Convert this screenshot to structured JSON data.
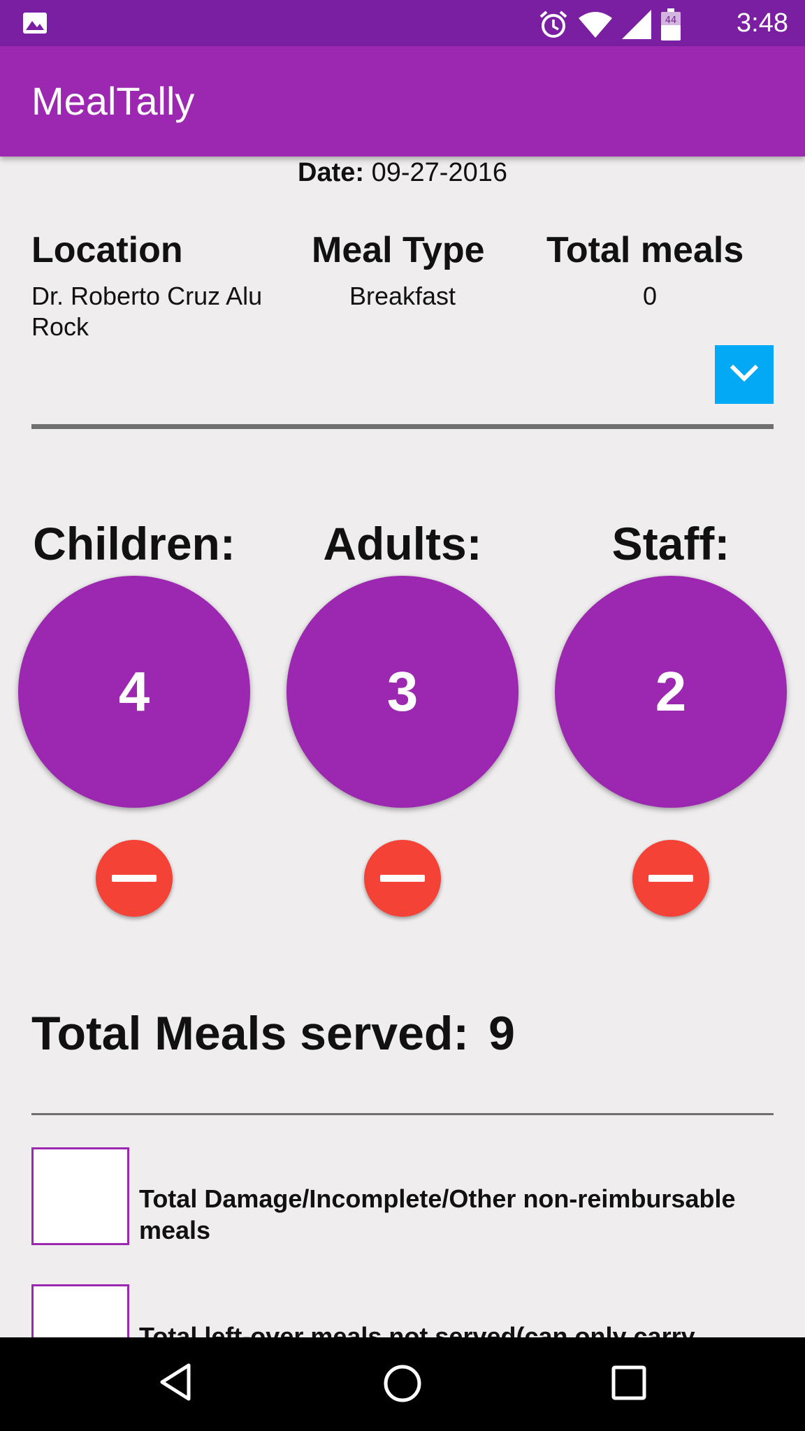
{
  "status_bar": {
    "time": "3:48",
    "battery_level": "44",
    "icons": [
      "gallery-icon",
      "alarm-icon",
      "wifi-icon",
      "signal-icon",
      "battery-icon"
    ]
  },
  "app_bar": {
    "title": "MealTally"
  },
  "date": {
    "label": "Date:",
    "value": "09-27-2016"
  },
  "summary": {
    "location_header": "Location",
    "location_value": "Dr. Roberto Cruz Alu Rock",
    "meal_type_header": "Meal Type",
    "meal_type_value": "Breakfast",
    "total_meals_header": "Total meals",
    "total_meals_value": "0"
  },
  "counters": [
    {
      "label": "Children:",
      "count": "4"
    },
    {
      "label": "Adults:",
      "count": "3"
    },
    {
      "label": "Staff:",
      "count": "2"
    }
  ],
  "total": {
    "label": "Total Meals served:",
    "value": "9"
  },
  "checkboxes": [
    {
      "label": "Total Damage/Incomplete/Other non-reimbursable meals"
    },
    {
      "label": "Total left-over meals not served(can only carry"
    }
  ],
  "colors": {
    "status_bar": "#7b1fa2",
    "app_bar": "#9c27b0",
    "counter": "#9c27b0",
    "minus": "#f44336",
    "dropdown": "#03a9f4"
  }
}
